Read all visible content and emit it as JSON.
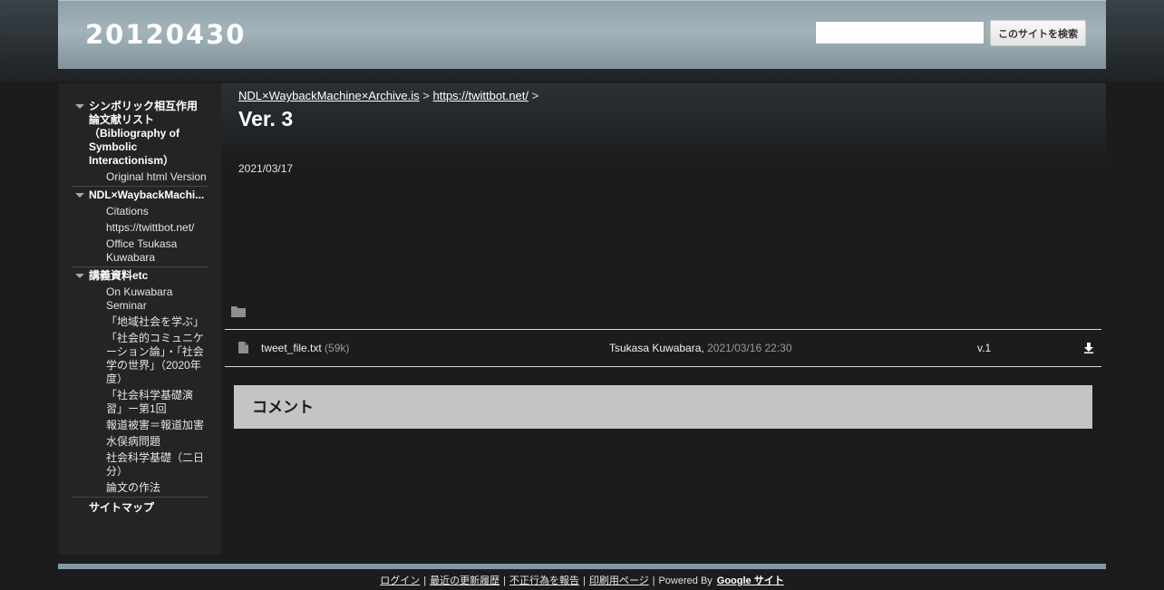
{
  "header": {
    "site_title": "20120430",
    "search_button": "このサイトを検索",
    "search_value": ""
  },
  "sidebar": {
    "sections": [
      {
        "label": "シンボリック相互作用論文献リスト（Bibliography of Symbolic Interactionism）",
        "items": [
          "Original html Version"
        ]
      },
      {
        "label": "NDL×WaybackMachi...",
        "items": [
          "Citations",
          "https://twittbot.net/",
          "Office Tsukasa Kuwabara"
        ]
      },
      {
        "label": "講義資料etc",
        "items": [
          "On Kuwabara Seminar",
          "「地域社会を学ぶ」",
          "「社会的コミュニケーション論」・「社会学の世界」（2020年度）",
          "「社会科学基礎演習」ー第1回",
          "報道被害＝報道加害",
          "水俣病問題",
          "社会科学基礎（二日分）",
          "論文の作法"
        ]
      }
    ],
    "sitemap": "サイトマップ"
  },
  "main": {
    "breadcrumb": {
      "link1": "NDL×WaybackMachine×Archive.is",
      "link2": "https://twittbot.net/",
      "sep": ">"
    },
    "title": "Ver. 3",
    "date": "2021/03/17",
    "file": {
      "name": "tweet_file.txt",
      "size": "(59k)",
      "user": "Tsukasa Kuwabara,",
      "time": "2021/03/16 22:30",
      "version": "v.1"
    },
    "comments_title": "コメント"
  },
  "footer": {
    "login": "ログイン",
    "recent": "最近の更新履歴",
    "report": "不正行為を報告",
    "print": "印刷用ページ",
    "powered": "Powered By",
    "brand": "Google サイト",
    "sep": "|"
  }
}
